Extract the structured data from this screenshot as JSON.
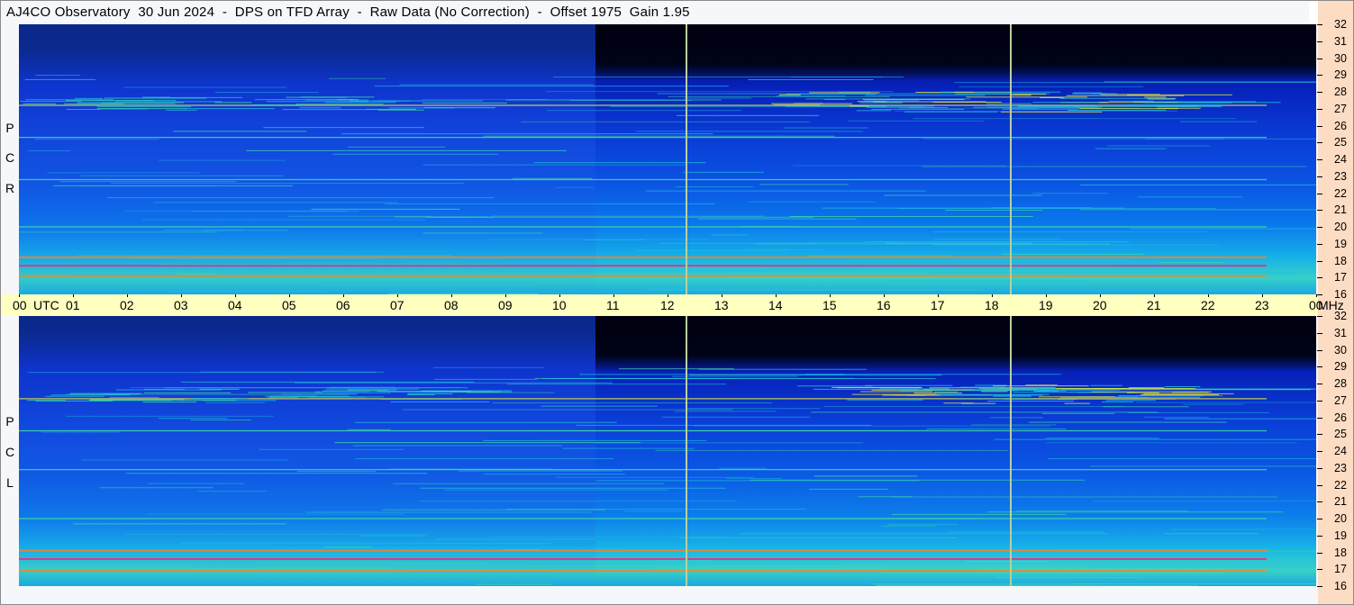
{
  "title": "AJ4CO Observatory  30 Jun 2024  -  DPS on TFD Array  -  Raw Data (No Correction)  -  Offset 1975  Gain 1.95",
  "chart_data": [
    {
      "type": "heatmap",
      "panel_label": "R C P",
      "x_ticks": [
        "00",
        "01",
        "02",
        "03",
        "04",
        "05",
        "06",
        "07",
        "08",
        "09",
        "10",
        "11",
        "12",
        "13",
        "14",
        "15",
        "16",
        "17",
        "18",
        "19",
        "20",
        "21",
        "22",
        "23",
        "00"
      ],
      "x_unit": "UTC",
      "x_range_hours": [
        0,
        24
      ],
      "y_ticks": [
        32,
        31,
        30,
        29,
        28,
        27,
        26,
        25,
        24,
        23,
        22,
        21,
        20,
        19,
        18,
        17,
        16
      ],
      "y_unit": "MHz",
      "y_range_mhz": [
        16,
        32
      ],
      "colormap": [
        "#000010",
        "#0010a0",
        "#0a3ad4",
        "#0a78ec",
        "#20c0e0",
        "#40e0a0",
        "#e0e040",
        "#ff8020",
        "#ff2080"
      ],
      "vertical_markers_utc": [
        12.35,
        18.35
      ],
      "strong_carriers_mhz": [
        17.1,
        17.7,
        18.2,
        20.0,
        22.8,
        25.3,
        27.2
      ]
    },
    {
      "type": "heatmap",
      "panel_label": "L C P",
      "x_ticks": [
        "00",
        "01",
        "02",
        "03",
        "04",
        "05",
        "06",
        "07",
        "08",
        "09",
        "10",
        "11",
        "12",
        "13",
        "14",
        "15",
        "16",
        "17",
        "18",
        "19",
        "20",
        "21",
        "22",
        "23",
        "00"
      ],
      "x_unit": "UTC",
      "x_range_hours": [
        0,
        24
      ],
      "y_ticks": [
        32,
        31,
        30,
        29,
        28,
        27,
        26,
        25,
        24,
        23,
        22,
        21,
        20,
        19,
        18,
        17,
        16
      ],
      "y_unit": "MHz",
      "y_range_mhz": [
        16,
        32
      ],
      "colormap": [
        "#000010",
        "#0010a0",
        "#0a3ad4",
        "#0a78ec",
        "#20c0e0",
        "#40e0a0",
        "#e0e040",
        "#ff8020",
        "#ff2080"
      ],
      "vertical_markers_utc": [
        12.35,
        18.35
      ],
      "strong_carriers_mhz": [
        16.9,
        17.6,
        18.1,
        20.0,
        22.9,
        25.2,
        27.1
      ]
    }
  ],
  "time_axis": {
    "labels": [
      "00",
      "UTC",
      "01",
      "02",
      "03",
      "04",
      "05",
      "06",
      "07",
      "08",
      "09",
      "10",
      "11",
      "12",
      "13",
      "14",
      "15",
      "16",
      "17",
      "18",
      "19",
      "20",
      "21",
      "22",
      "23",
      "00",
      "MHz"
    ]
  },
  "panel_labels": {
    "top": [
      "R",
      "C",
      "P"
    ],
    "bottom": [
      "L",
      "C",
      "P"
    ]
  }
}
